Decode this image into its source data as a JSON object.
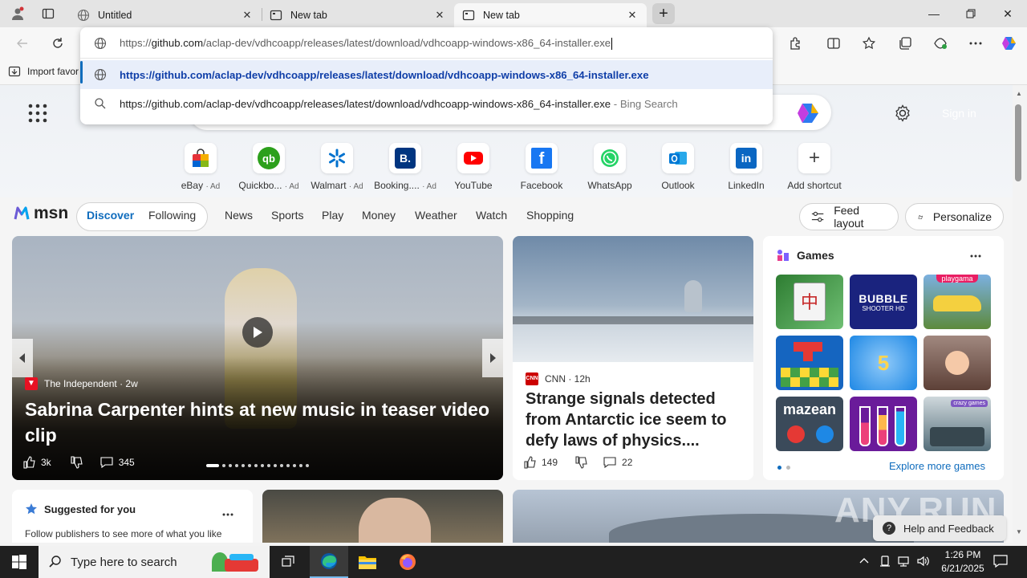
{
  "tabs": [
    {
      "label": "Untitled"
    },
    {
      "label": "New tab"
    },
    {
      "label": "New tab"
    }
  ],
  "address": {
    "value": "https://github.com/aclap-dev/vdhcoapp/releases/latest/download/vdhcoapp-windows-x86_64-installer.exe",
    "value_host_prefix": "https://",
    "value_host": "github.com",
    "value_path": "/aclap-dev/vdhcoapp/releases/latest/download/vdhcoapp-windows-x86_64-installer.exe"
  },
  "suggestions": [
    {
      "text": "https://github.com/aclap-dev/vdhcoapp/releases/latest/download/vdhcoapp-windows-x86_64-installer.exe",
      "suffix": ""
    },
    {
      "text": "https://github.com/aclap-dev/vdhcoapp/releases/latest/download/vdhcoapp-windows-x86_64-installer.exe",
      "suffix": " - Bing Search"
    }
  ],
  "favorites_bar": {
    "import_label": "Import favor"
  },
  "header": {
    "sign_in": "Sign in"
  },
  "shortcuts": [
    {
      "label": "eBay",
      "ad": "· Ad",
      "color": "#e53238"
    },
    {
      "label": "Quickbo...",
      "ad": "· Ad",
      "color": "#2ca01c"
    },
    {
      "label": "Walmart",
      "ad": "· Ad",
      "color": "#0071ce"
    },
    {
      "label": "Booking....",
      "ad": "· Ad",
      "color": "#003580"
    },
    {
      "label": "YouTube",
      "ad": "",
      "color": "#ff0000"
    },
    {
      "label": "Facebook",
      "ad": "",
      "color": "#1877f2"
    },
    {
      "label": "WhatsApp",
      "ad": "",
      "color": "#25d366"
    },
    {
      "label": "Outlook",
      "ad": "",
      "color": "#0078d4"
    },
    {
      "label": "LinkedIn",
      "ad": "",
      "color": "#0a66c2"
    },
    {
      "label": "Add shortcut",
      "ad": "",
      "color": "#555555"
    }
  ],
  "msn": {
    "logo": "msn",
    "tabs": [
      "Discover",
      "Following"
    ],
    "nav": [
      "News",
      "Sports",
      "Play",
      "Money",
      "Weather",
      "Watch",
      "Shopping"
    ],
    "feed_layout": "Feed layout",
    "personalize": "Personalize"
  },
  "hero_story": {
    "source": "The Independent",
    "age": "· 2w",
    "title": "Sabrina Carpenter hints at new music in teaser video clip",
    "likes": "3k",
    "comments": "345"
  },
  "cnn_story": {
    "source": "CNN",
    "age": "· 12h",
    "title": "Strange signals detected from Antarctic ice seem to defy laws of physics....",
    "likes": "149",
    "comments": "22"
  },
  "games": {
    "title": "Games",
    "explore": "Explore more games",
    "tiles": [
      "Mahjong",
      "BUBBLE SHOOTER HD",
      "playgama",
      "Blocks",
      "5",
      "Story",
      "mazean",
      "Sort",
      "crazy games"
    ]
  },
  "suggested": {
    "title": "Suggested for you",
    "text": "Follow publishers to see more of what you like"
  },
  "help": {
    "label": "Help and Feedback"
  },
  "watermark": "ANY.RUN",
  "taskbar": {
    "search_placeholder": "Type here to search",
    "time": "1:26 PM",
    "date": "6/21/2025"
  }
}
